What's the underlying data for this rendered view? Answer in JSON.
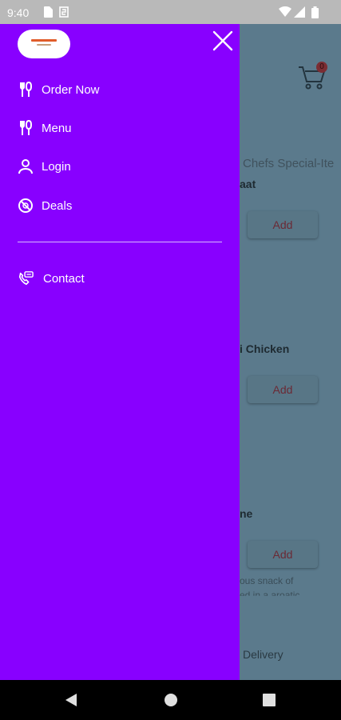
{
  "status_bar": {
    "time": "9:40"
  },
  "background": {
    "cart_count": "0",
    "category_tab": "Chefs Special-Ite",
    "items": [
      {
        "name": "aat",
        "add_label": "Add"
      },
      {
        "name": "i Chicken",
        "add_label": "Add"
      },
      {
        "name": "ne",
        "add_label": "Add",
        "description_line1": "ous snack of",
        "description_line2": "ed in a aroatic"
      }
    ],
    "delivery_label": "Delivery"
  },
  "drawer": {
    "menu_items": [
      {
        "label": "Order Now",
        "icon": "utensils-icon"
      },
      {
        "label": "Menu",
        "icon": "utensils-icon"
      },
      {
        "label": "Login",
        "icon": "person-icon"
      },
      {
        "label": "Deals",
        "icon": "no-sign-icon"
      }
    ],
    "secondary_items": [
      {
        "label": "Contact",
        "icon": "phone-icon"
      }
    ]
  },
  "colors": {
    "drawer_bg": "#8800ff",
    "overlay": "#5b7a8c"
  }
}
